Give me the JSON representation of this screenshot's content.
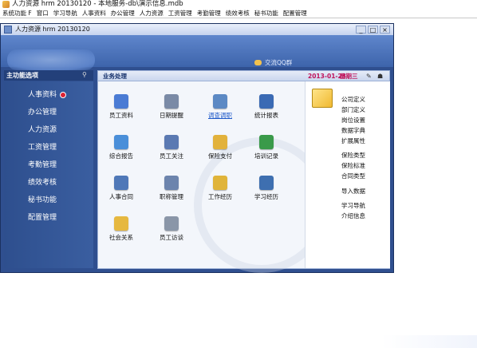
{
  "app": {
    "title": "人力资源 hrm 20130120 - 本地服务-db\\演示信息.mdb"
  },
  "menu": [
    "系统功能 F",
    "窗口",
    "学习导航",
    "人事资料",
    "办公管理",
    "人力资源",
    "工资管理",
    "考勤管理",
    "绩效考核",
    "秘书功能",
    "配置管理"
  ],
  "window": {
    "title": "人力资源 hrm 20130120",
    "controls": [
      "_",
      "□",
      "×"
    ]
  },
  "banner": {
    "qq_label": "交流QQ群"
  },
  "sidebar": {
    "header": "主功能选项",
    "items": [
      "人事资料",
      "办公管理",
      "人力资源",
      "工资管理",
      "考勤管理",
      "绩效考核",
      "秘书功能",
      "配置管理"
    ]
  },
  "content": {
    "title": "业务处理",
    "date": "2013-01-23",
    "weekday": "星期三"
  },
  "tiles": [
    {
      "label": "员工资料",
      "icon": "employee-records-icon",
      "color": "#4a7bd4"
    },
    {
      "label": "日期提醒",
      "icon": "date-reminder-icon",
      "color": "#7a8aa6"
    },
    {
      "label": "调查调职",
      "icon": "transfer-search-icon",
      "color": "#5c89c4",
      "link": true
    },
    {
      "label": "统计报表",
      "icon": "statistics-report-icon",
      "color": "#3a6ab4"
    },
    {
      "label": "综合报告",
      "icon": "summary-report-icon",
      "color": "#4a8fd9"
    },
    {
      "label": "员工关注",
      "icon": "employee-care-icon",
      "color": "#5a79b2"
    },
    {
      "label": "保险支付",
      "icon": "insurance-payment-icon",
      "color": "#e2b23c"
    },
    {
      "label": "培训记录",
      "icon": "training-record-icon",
      "color": "#3a9a4a"
    },
    {
      "label": "人事合同",
      "icon": "hr-contract-icon",
      "color": "#4f78b8"
    },
    {
      "label": "职称管理",
      "icon": "title-management-icon",
      "color": "#6c84ad"
    },
    {
      "label": "工作经历",
      "icon": "work-history-icon",
      "color": "#e0b43a"
    },
    {
      "label": "学习经历",
      "icon": "study-history-icon",
      "color": "#3e6fb0"
    },
    {
      "label": "社会关系",
      "icon": "social-relations-icon",
      "color": "#e6b840"
    },
    {
      "label": "员工访谈",
      "icon": "employee-interview-icon",
      "color": "#8a96a8"
    }
  ],
  "right_links": [
    "公司定义",
    "部门定义",
    "岗位设置",
    "数据字典",
    "扩展属性",
    "保险类型",
    "保险标准",
    "合同类型",
    "导入数据",
    "学习导航",
    "介绍信息"
  ]
}
